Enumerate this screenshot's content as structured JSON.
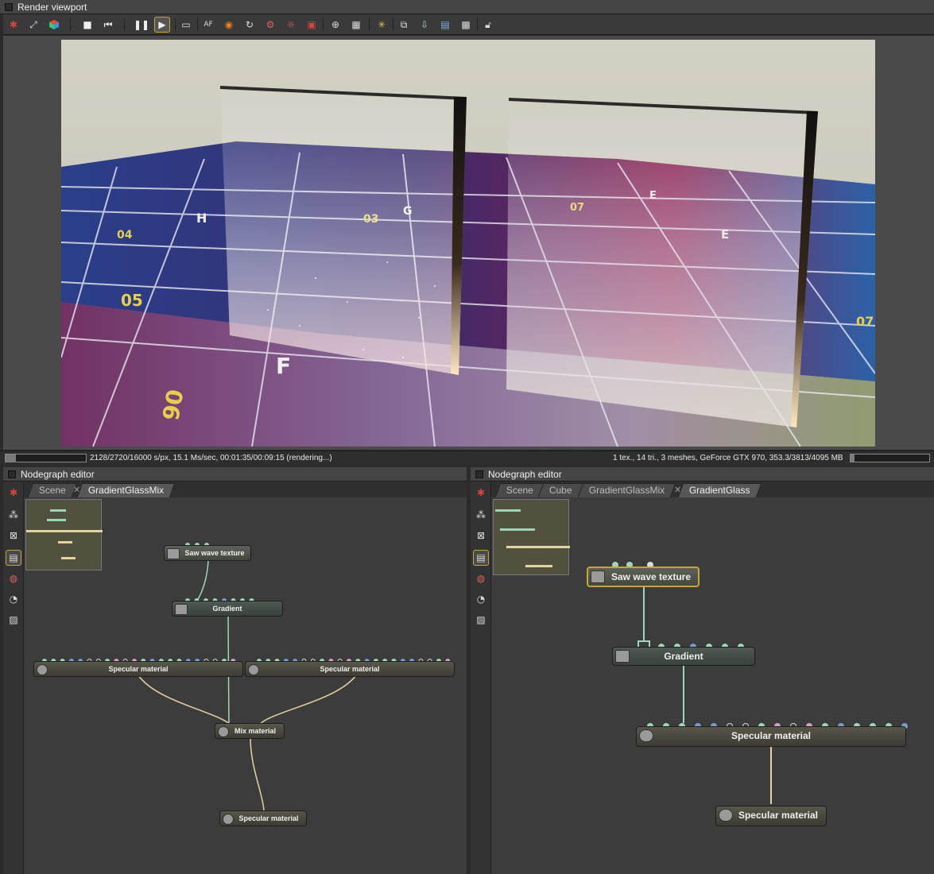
{
  "render_panel": {
    "title": "Render viewport"
  },
  "toolbar": {
    "icons": [
      "reset-icon",
      "fit-icon",
      "color-cube-icon",
      "stop-icon",
      "restart-icon",
      "pause-icon",
      "start-icon",
      "display-icon",
      "af-icon",
      "color-icon",
      "rotate-icon",
      "settings-icon",
      "denoise-icon",
      "region-icon",
      "zoom-icon",
      "grid-icon",
      "sparkle-icon",
      "copy-icon",
      "export-icon",
      "save-icon",
      "pattern-icon",
      "lock-icon"
    ],
    "af_label": "AF"
  },
  "status": {
    "left": "2128/2720/16000 s/px, 15.1 Ms/sec, 00:01:35/00:09:15 (rendering...)",
    "right": "1 tex., 14 tri., 3 meshes, GeForce GTX 970, 353.3/3813/4095 MB",
    "left_progress": 0.13,
    "right_progress": 0.05
  },
  "nodegraph_left": {
    "title": "Nodegraph editor",
    "tabs": [
      "Scene",
      "GradientGlassMix"
    ],
    "nodes": {
      "saw": "Saw wave texture",
      "gradient": "Gradient",
      "spec1": "Specular material",
      "spec2": "Specular material",
      "mix": "Mix material",
      "out": "Specular material"
    }
  },
  "nodegraph_right": {
    "title": "Nodegraph editor",
    "tabs": [
      "Scene",
      "Cube",
      "GradientGlassMix",
      "GradientGlass"
    ],
    "nodes": {
      "saw": "Saw wave texture",
      "gradient": "Gradient",
      "spec": "Specular material",
      "out": "Specular material"
    }
  },
  "colors": {
    "accent": "#c9a436",
    "panel": "#3a3a3a",
    "wire_green": "#9ed7b8",
    "wire_tan": "#e2d3a0"
  }
}
